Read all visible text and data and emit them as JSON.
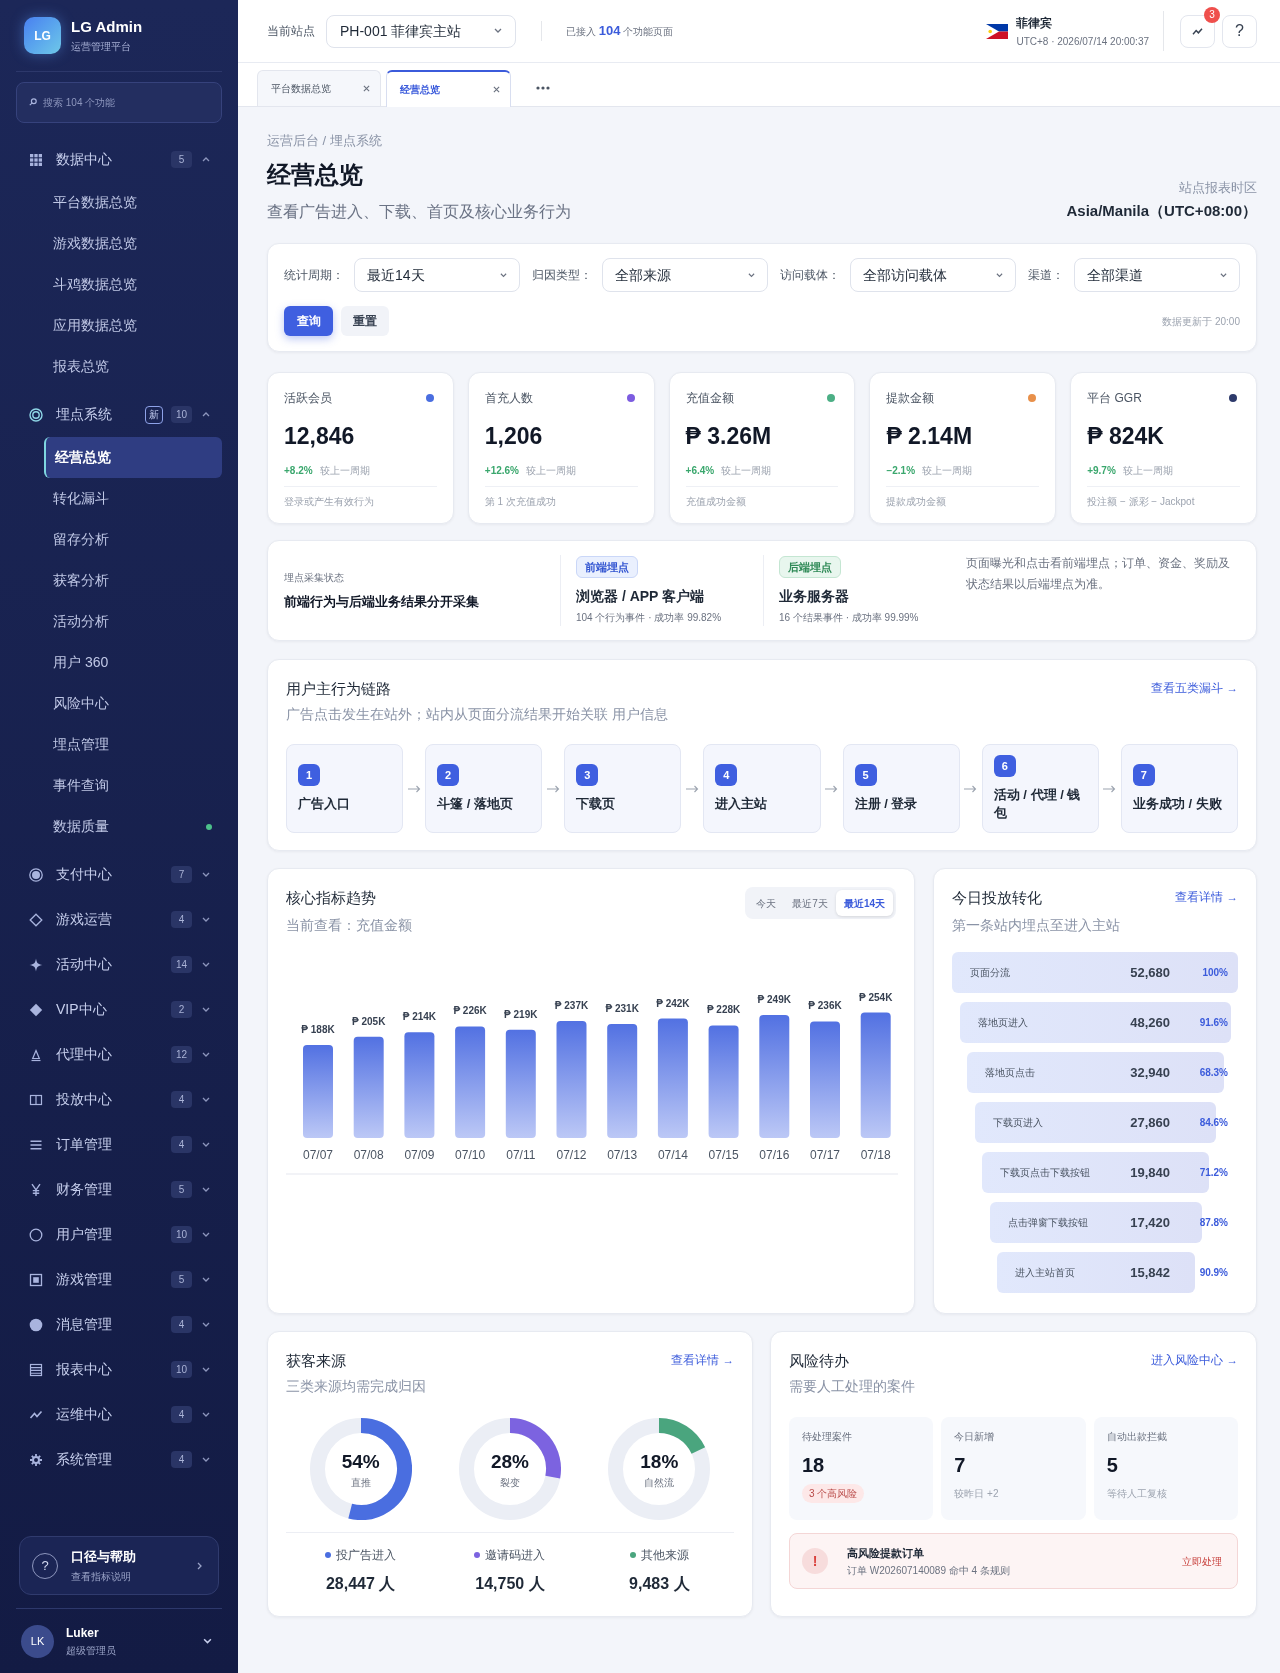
{
  "sidebar": {
    "logo": {
      "initials": "LG",
      "title": "LG Admin",
      "subtitle": "运营管理平台"
    },
    "search": {
      "placeholder": "搜索 104 个功能"
    },
    "groups": [
      {
        "label": "数据中心",
        "count": "5",
        "expanded": true,
        "children": [
          {
            "label": "平台数据总览",
            "selected": false,
            "dot": false
          },
          {
            "label": "游戏数据总览",
            "selected": false,
            "dot": false
          },
          {
            "label": "斗鸡数据总览",
            "selected": false,
            "dot": false
          },
          {
            "label": "应用数据总览",
            "selected": false,
            "dot": false
          },
          {
            "label": "报表总览",
            "selected": false,
            "dot": false
          }
        ]
      },
      {
        "label": "埋点系统",
        "badge": "新",
        "count": "10",
        "expanded": true,
        "children": [
          {
            "label": "经营总览",
            "selected": true,
            "dot": false
          },
          {
            "label": "转化漏斗",
            "selected": false,
            "dot": false
          },
          {
            "label": "留存分析",
            "selected": false,
            "dot": false
          },
          {
            "label": "获客分析",
            "selected": false,
            "dot": false
          },
          {
            "label": "活动分析",
            "selected": false,
            "dot": false
          },
          {
            "label": "用户 360",
            "selected": false,
            "dot": false
          },
          {
            "label": "风险中心",
            "selected": false,
            "dot": false
          },
          {
            "label": "埋点管理",
            "selected": false,
            "dot": false
          },
          {
            "label": "事件查询",
            "selected": false,
            "dot": false
          },
          {
            "label": "数据质量",
            "selected": false,
            "dot": true
          }
        ]
      },
      {
        "label": "支付中心",
        "count": "7",
        "expanded": false
      },
      {
        "label": "游戏运营",
        "count": "4",
        "expanded": false
      },
      {
        "label": "活动中心",
        "count": "14",
        "expanded": false
      },
      {
        "label": "VIP中心",
        "count": "2",
        "expanded": false
      },
      {
        "label": "代理中心",
        "count": "12",
        "expanded": false
      },
      {
        "label": "投放中心",
        "count": "4",
        "expanded": false
      },
      {
        "label": "订单管理",
        "count": "4",
        "expanded": false
      },
      {
        "label": "财务管理",
        "count": "5",
        "expanded": false
      },
      {
        "label": "用户管理",
        "count": "10",
        "expanded": false
      },
      {
        "label": "游戏管理",
        "count": "5",
        "expanded": false
      },
      {
        "label": "消息管理",
        "count": "4",
        "expanded": false
      },
      {
        "label": "报表中心",
        "count": "10",
        "expanded": false
      },
      {
        "label": "运维中心",
        "count": "4",
        "expanded": false
      },
      {
        "label": "系统管理",
        "count": "4",
        "expanded": false
      }
    ],
    "help": {
      "icon": "?",
      "title": "口径与帮助",
      "subtitle": "查看指标说明"
    },
    "user": {
      "initials": "LK",
      "name": "Luker",
      "role": "超级管理员"
    }
  },
  "header": {
    "site_label": "当前站点",
    "site_value": "PH-001 菲律宾主站",
    "pages_note": "已接入 **104** 个功能页面",
    "region": "菲律宾",
    "clock": "UTC+8 · 2026/07/14 20:00:37",
    "notifications": "3",
    "help_label": "?"
  },
  "tabs": [
    {
      "label": "平台数据总览",
      "selected": false
    },
    {
      "label": "经营总览",
      "selected": true
    }
  ],
  "page": {
    "breadcrumb": "运营后台 / 埋点系统",
    "title": "经营总览",
    "subtitle": "查看广告进入、下载、首页及核心业务行为",
    "timezone_label": "站点报表时区",
    "timezone": "Asia/Manila（UTC+08:00）"
  },
  "filters": {
    "fields": [
      {
        "label": "统计周期：",
        "value": "最近14天"
      },
      {
        "label": "归因类型：",
        "value": "全部来源"
      },
      {
        "label": "访问载体：",
        "value": "全部访问载体"
      },
      {
        "label": "渠道：",
        "value": "全部渠道"
      }
    ],
    "buttons": [
      {
        "label": "查询",
        "kind": "primary"
      },
      {
        "label": "重置",
        "kind": "secondary"
      }
    ],
    "updated": "数据更新于 20:00"
  },
  "kpis": [
    {
      "label": "活跃会员",
      "value": "12,846",
      "change": "+8.2%",
      "compare": "较上一周期",
      "note": "登录或产生有效行为",
      "color": "#4a6ee0"
    },
    {
      "label": "首充人数",
      "value": "1,206",
      "change": "+12.6%",
      "compare": "较上一周期",
      "note": "第 1 次充值成功",
      "color": "#7c5ce0"
    },
    {
      "label": "充值金额",
      "value": "₱ 3.26M",
      "change": "+6.4%",
      "compare": "较上一周期",
      "note": "充值成功金额",
      "color": "#4caf85"
    },
    {
      "label": "提款金额",
      "value": "₱ 2.14M",
      "change": "−2.1%",
      "compare": "较上一周期",
      "note": "提款成功金额",
      "color": "#e8904a"
    },
    {
      "label": "平台 GGR",
      "value": "₱ 824K",
      "change": "+9.7%",
      "compare": "较上一周期",
      "note": "投注额 − 派彩 − Jackpot",
      "color": "#2d3a6b"
    }
  ],
  "collection": {
    "title": "埋点采集状态",
    "headline": "前端行为与后端业务结果分开采集",
    "channels": [
      {
        "tag": "前端埋点",
        "kind": "frontend",
        "name": "浏览器 / APP 客户端",
        "stats": "104 个行为事件 · 成功率 99.82%"
      },
      {
        "tag": "后端埋点",
        "kind": "backend",
        "name": "业务服务器",
        "stats": "16 个结果事件 · 成功率 99.99%"
      }
    ],
    "note": "页面曝光和点击看前端埋点；订单、资金、奖励及状态结果以后端埋点为准。"
  },
  "flow": {
    "title": "用户主行为链路",
    "link": "查看五类漏斗 →",
    "subtitle": "广告点击发生在站外；站内从页面分流结果开始关联 用户信息",
    "steps": [
      {
        "number": "1",
        "label": "广告入口"
      },
      {
        "number": "2",
        "label": "斗篷 / 落地页"
      },
      {
        "number": "3",
        "label": "下载页"
      },
      {
        "number": "4",
        "label": "进入主站"
      },
      {
        "number": "5",
        "label": "注册 / 登录"
      },
      {
        "number": "6",
        "label": "活动 / 代理 / 钱包"
      },
      {
        "number": "7",
        "label": "业务成功 / 失败"
      }
    ]
  },
  "trend": {
    "title": "核心指标趋势",
    "subtitle": "当前查看：充值金额",
    "ranges": [
      {
        "label": "今天",
        "selected": false
      },
      {
        "label": "最近7天",
        "selected": false
      },
      {
        "label": "最近14天",
        "selected": true
      }
    ],
    "chart_data": {
      "type": "bar",
      "categories": [
        "07/07",
        "07/08",
        "07/09",
        "07/10",
        "07/11",
        "07/12",
        "07/13",
        "07/14",
        "07/15",
        "07/16",
        "07/17",
        "07/18"
      ],
      "values": [
        188,
        205,
        214,
        226,
        219,
        237,
        231,
        242,
        228,
        249,
        236,
        254
      ],
      "value_labels": [
        "₱ 188K",
        "₱ 205K",
        "₱ 214K",
        "₱ 226K",
        "₱ 219K",
        "₱ 237K",
        "₱ 231K",
        "₱ 242K",
        "₱ 228K",
        "₱ 249K",
        "₱ 236K",
        "₱ 254K"
      ]
    }
  },
  "funnel": {
    "title": "今日投放转化",
    "link": "查看详情 →",
    "subtitle": "第一条站内埋点至进入主站",
    "steps": [
      {
        "label": "页面分流",
        "value": "52,680",
        "rate": "100%"
      },
      {
        "label": "落地页进入",
        "value": "48,260",
        "rate": "91.6%"
      },
      {
        "label": "落地页点击",
        "value": "32,940",
        "rate": "68.3%"
      },
      {
        "label": "下载页进入",
        "value": "27,860",
        "rate": "84.6%"
      },
      {
        "label": "下载页点击下载按钮",
        "value": "19,840",
        "rate": "71.2%"
      },
      {
        "label": "点击弹窗下载按钮",
        "value": "17,420",
        "rate": "87.8%"
      },
      {
        "label": "进入主站首页",
        "value": "15,842",
        "rate": "90.9%"
      }
    ]
  },
  "sources": {
    "title": "获客来源",
    "link": "查看详情 →",
    "subtitle": "三类来源均需完成归因",
    "items": [
      {
        "percent": "54%",
        "label": "直推",
        "color": "#4a6ee0",
        "legend": "投广告进入",
        "count": "28,447 人"
      },
      {
        "percent": "28%",
        "label": "裂变",
        "color": "#7c63e0",
        "legend": "邀请码进入",
        "count": "14,750 人"
      },
      {
        "percent": "18%",
        "label": "自然流",
        "color": "#4aa57e",
        "legend": "其他来源",
        "count": "9,483 人"
      }
    ]
  },
  "risk": {
    "title": "风险待办",
    "link": "进入风险中心 →",
    "subtitle": "需要人工处理的案件",
    "stats": [
      {
        "label": "待处理案件",
        "value": "18",
        "badge": "3 个高风险"
      },
      {
        "label": "今日新增",
        "value": "7",
        "note": "较昨日 +2"
      },
      {
        "label": "自动出款拦截",
        "value": "5",
        "note": "等待人工复核"
      }
    ],
    "alert": {
      "icon": "!",
      "title": "高风险提款订单",
      "detail": "订单 W202607140089 命中 4 条规则",
      "action": "立即处理"
    }
  }
}
